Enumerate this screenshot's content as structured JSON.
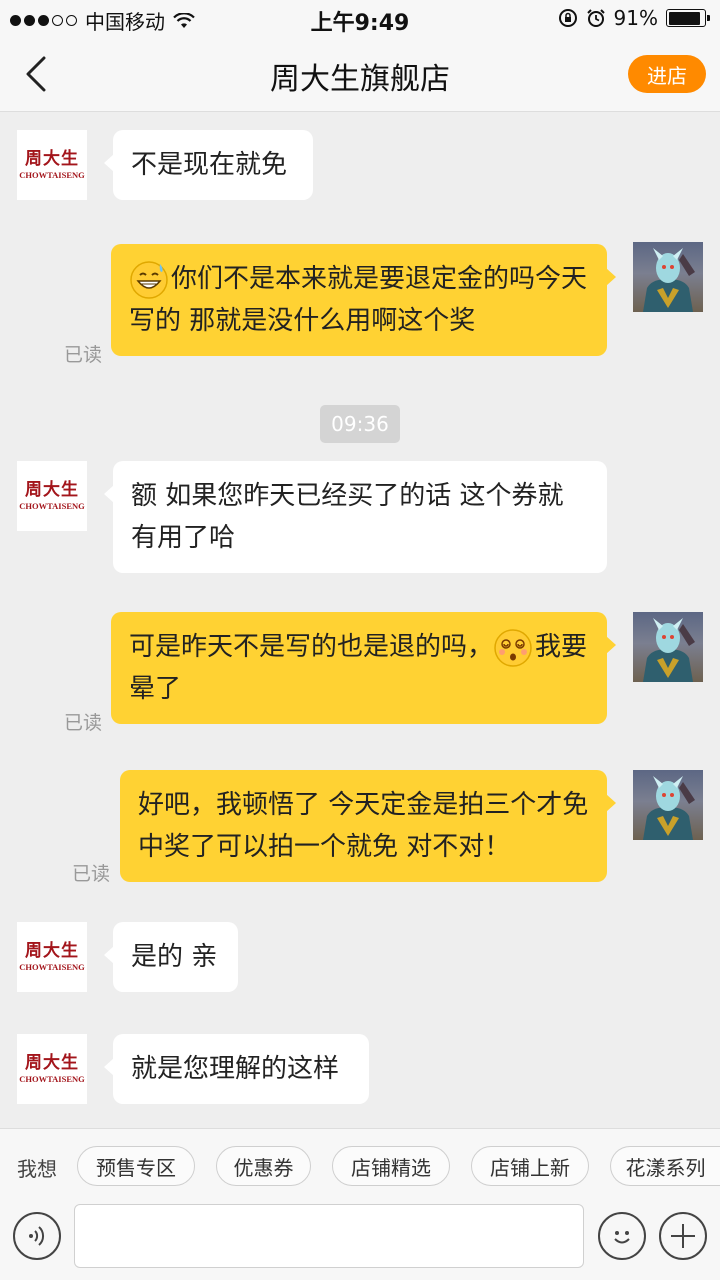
{
  "status_bar": {
    "carrier": "中国移动",
    "time": "上午9:49",
    "battery": "91%",
    "battery_level": 0.91
  },
  "header": {
    "title": "周大生旗舰店",
    "enter_shop_label": "进店"
  },
  "shop_logo": {
    "cn": "周大生",
    "en": "CHOWTAISENG"
  },
  "read_label": "已读",
  "messages": [
    {
      "side": "in",
      "text": "不是现在就免"
    },
    {
      "side": "out",
      "emoji": "grin-sweat",
      "text": "你们不是本来就是要退定金的吗今天写的 那就是没什么用啊这个奖",
      "status": "已读"
    },
    {
      "side": "in",
      "text": "额 如果您昨天已经买了的话 这个券就有用了哈"
    },
    {
      "side": "out",
      "text_before": "可是昨天不是写的也是退的吗，",
      "emoji": "dizzy-face",
      "text_after": "我要晕了",
      "status": "已读"
    },
    {
      "side": "out",
      "text": "好吧，我顿悟了 今天定金是拍三个才免 中奖了可以拍一个就免 对不对！",
      "status": "已读"
    },
    {
      "side": "in",
      "text": "是的 亲"
    },
    {
      "side": "in",
      "text": "就是您理解的这样"
    }
  ],
  "timestamp": "09:36",
  "quick_bar": {
    "prefix": "我想",
    "chips": [
      "预售专区",
      "优惠券",
      "店铺精选",
      "店铺上新",
      "花漾系列"
    ]
  },
  "input_bar": {
    "voice_icon": "voice-icon",
    "emoji_icon": "smiley-icon",
    "plus_icon": "plus-icon"
  }
}
